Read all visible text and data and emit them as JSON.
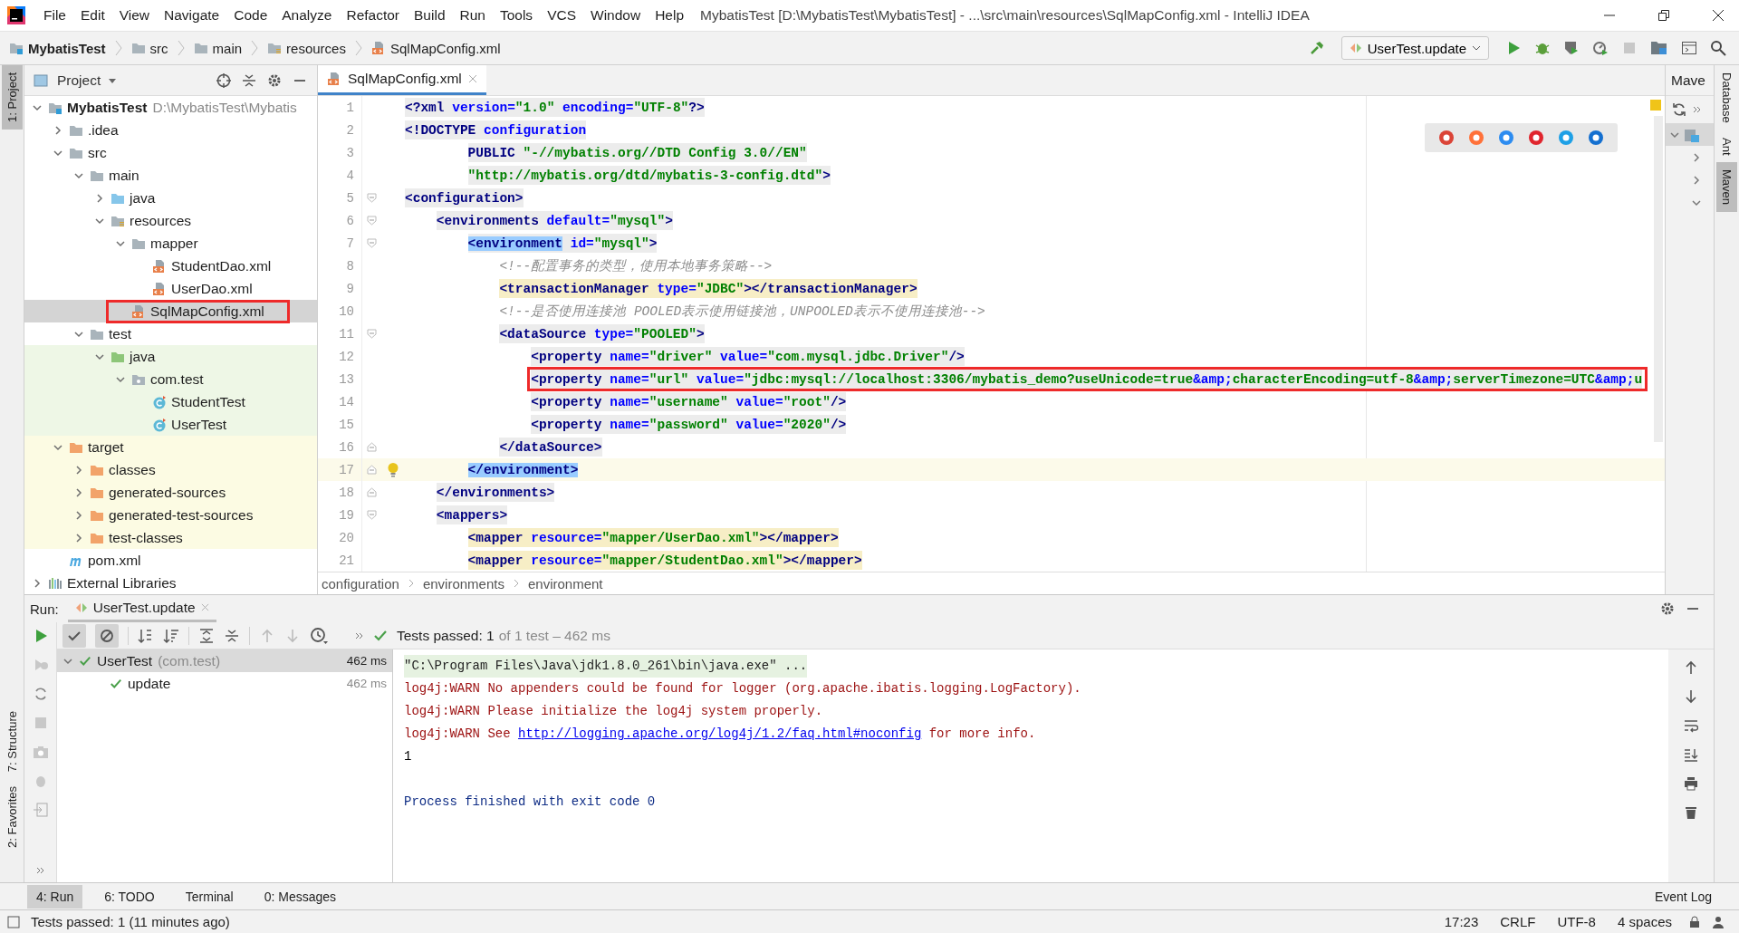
{
  "window": {
    "title": "MybatisTest [D:\\MybatisTest\\MybatisTest] - ...\\src\\main\\resources\\SqlMapConfig.xml - IntelliJ IDEA"
  },
  "menu": [
    "File",
    "Edit",
    "View",
    "Navigate",
    "Code",
    "Analyze",
    "Refactor",
    "Build",
    "Run",
    "Tools",
    "VCS",
    "Window",
    "Help"
  ],
  "breadcrumbs": [
    {
      "label": "MybatisTest",
      "kind": "module"
    },
    {
      "label": "src",
      "kind": "folder"
    },
    {
      "label": "main",
      "kind": "folder"
    },
    {
      "label": "resources",
      "kind": "resources-folder"
    },
    {
      "label": "SqlMapConfig.xml",
      "kind": "xml"
    }
  ],
  "run_config": "UserTest.update",
  "left_tool_windows": [
    {
      "label": "1: Project",
      "selected": true
    },
    {
      "label": "7: Structure",
      "selected": false
    },
    {
      "label": "2: Favorites",
      "selected": false
    }
  ],
  "right_tool_windows": [
    {
      "label": "Database",
      "selected": false
    },
    {
      "label": "Ant",
      "selected": false
    },
    {
      "label": "Maven",
      "selected": true
    }
  ],
  "project": {
    "title": "Project",
    "tree": [
      {
        "label": "MybatisTest",
        "path": "D:\\MybatisTest\\Mybatis",
        "kind": "module",
        "expanded": true,
        "selected": false,
        "children": [
          {
            "label": ".idea",
            "kind": "folder",
            "expanded": false,
            "selected": false
          },
          {
            "label": "src",
            "kind": "folder",
            "expanded": true,
            "selected": false,
            "children": [
              {
                "label": "main",
                "kind": "folder",
                "expanded": true,
                "selected": false,
                "children": [
                  {
                    "label": "java",
                    "kind": "source-folder",
                    "expanded": false,
                    "selected": false
                  },
                  {
                    "label": "resources",
                    "kind": "resources-folder",
                    "expanded": true,
                    "selected": false,
                    "children": [
                      {
                        "label": "mapper",
                        "kind": "folder",
                        "expanded": true,
                        "selected": false,
                        "children": [
                          {
                            "label": "StudentDao.xml",
                            "kind": "xml",
                            "selected": false
                          },
                          {
                            "label": "UserDao.xml",
                            "kind": "xml",
                            "selected": false
                          }
                        ]
                      },
                      {
                        "label": "SqlMapConfig.xml",
                        "kind": "xml",
                        "selected": true,
                        "annotated": true
                      }
                    ]
                  }
                ]
              },
              {
                "label": "test",
                "kind": "folder",
                "expanded": true,
                "selected": false,
                "children": [
                  {
                    "label": "java",
                    "kind": "test-folder",
                    "color": "#eef7e6",
                    "expanded": true,
                    "selected": false,
                    "children": [
                      {
                        "label": "com.test",
                        "kind": "package",
                        "color": "#eef7e6",
                        "expanded": true,
                        "selected": false,
                        "children": [
                          {
                            "label": "StudentTest",
                            "kind": "class",
                            "color": "#eef7e6",
                            "selected": false
                          },
                          {
                            "label": "UserTest",
                            "kind": "class",
                            "color": "#eef7e6",
                            "selected": false
                          }
                        ]
                      }
                    ]
                  }
                ]
              }
            ]
          },
          {
            "label": "target",
            "kind": "excluded-folder",
            "color": "#fcfbe3",
            "expanded": true,
            "selected": false,
            "children": [
              {
                "label": "classes",
                "kind": "excluded-folder",
                "color": "#fcfbe3",
                "expanded": false,
                "selected": false
              },
              {
                "label": "generated-sources",
                "kind": "excluded-folder",
                "color": "#fcfbe3",
                "expanded": false,
                "selected": false
              },
              {
                "label": "generated-test-sources",
                "kind": "excluded-folder",
                "color": "#fcfbe3",
                "expanded": false,
                "selected": false
              },
              {
                "label": "test-classes",
                "kind": "excluded-folder",
                "color": "#fcfbe3",
                "expanded": false,
                "selected": false
              }
            ]
          },
          {
            "label": "pom.xml",
            "kind": "maven",
            "selected": false
          }
        ]
      },
      {
        "label": "External Libraries",
        "kind": "library",
        "expanded": false,
        "selected": false
      }
    ]
  },
  "editor": {
    "tab": "SqlMapConfig.xml",
    "lines": [
      {
        "number": "1",
        "color": "#ececec",
        "current": false,
        "tokens": [
          {
            "kind": "tag",
            "text": "<?xml"
          },
          {
            "kind": "attr",
            "text": " version="
          },
          {
            "kind": "value",
            "text": "\"1.0\""
          },
          {
            "kind": "attr",
            "text": " encoding="
          },
          {
            "kind": "value",
            "text": "\"UTF-8\""
          },
          {
            "kind": "tag",
            "text": "?>"
          }
        ]
      },
      {
        "number": "2",
        "color": "#ececec",
        "current": false,
        "tokens": [
          {
            "kind": "tag",
            "text": "<!DOCTYPE"
          },
          {
            "kind": "attr",
            "text": " configuration"
          }
        ]
      },
      {
        "number": "3",
        "color": "#ececec",
        "current": false,
        "continuation": true,
        "tokens": [
          {
            "kind": "tag",
            "text": "PUBLIC"
          },
          {
            "kind": "value",
            "text": " \"-//mybatis.org//DTD Config 3.0//EN\""
          }
        ]
      },
      {
        "number": "4",
        "color": "#ececec",
        "current": false,
        "continuation": true,
        "tokens": [
          {
            "kind": "value",
            "text": "\"http://mybatis.org/dtd/mybatis-3-config.dtd\""
          },
          {
            "kind": "tag",
            "text": ">"
          }
        ]
      },
      {
        "number": "5",
        "color": "#ececec",
        "current": false,
        "fold_start": true,
        "tokens": [
          {
            "kind": "tag",
            "text": "<configuration>"
          }
        ]
      },
      {
        "number": "6",
        "color": "#ececec",
        "current": false,
        "fold_start": true,
        "tokens": [
          {
            "kind": "tag",
            "text": "<environments"
          },
          {
            "kind": "attr",
            "text": " default="
          },
          {
            "kind": "value",
            "text": "\"mysql\""
          },
          {
            "kind": "tag",
            "text": ">"
          }
        ]
      },
      {
        "number": "7",
        "color": "#ececec",
        "current": false,
        "fold_start": true,
        "tokens": [
          {
            "kind": "matched",
            "text": "<environment"
          },
          {
            "kind": "attr",
            "text": " id="
          },
          {
            "kind": "value",
            "text": "\"mysql\""
          },
          {
            "kind": "tag",
            "text": ">"
          }
        ]
      },
      {
        "number": "8",
        "current": false,
        "tokens": [
          {
            "kind": "comment",
            "text": "<!--配置事务的类型，使用本地事务策略-->"
          }
        ]
      },
      {
        "number": "9",
        "color": "#f7eec6",
        "current": false,
        "tokens": [
          {
            "kind": "tag",
            "text": "<transactionManager"
          },
          {
            "kind": "attr",
            "text": " type="
          },
          {
            "kind": "value",
            "text": "\"JDBC\""
          },
          {
            "kind": "tag",
            "text": "></transactionManager>"
          }
        ]
      },
      {
        "number": "10",
        "current": false,
        "tokens": [
          {
            "kind": "comment",
            "text": "<!--是否使用连接池 POOLED表示使用链接池，UNPOOLED表示不使用连接池-->"
          }
        ]
      },
      {
        "number": "11",
        "color": "#ececec",
        "current": false,
        "fold_start": true,
        "tokens": [
          {
            "kind": "tag",
            "text": "<dataSource"
          },
          {
            "kind": "attr",
            "text": " type="
          },
          {
            "kind": "value",
            "text": "\"POOLED\""
          },
          {
            "kind": "tag",
            "text": ">"
          }
        ]
      },
      {
        "number": "12",
        "color": "#ececec",
        "current": false,
        "tokens": [
          {
            "kind": "tag",
            "text": "<property"
          },
          {
            "kind": "attr",
            "text": " name="
          },
          {
            "kind": "value",
            "text": "\"driver\""
          },
          {
            "kind": "attr",
            "text": " value="
          },
          {
            "kind": "value",
            "text": "\"com.mysql.jdbc.Driver\""
          },
          {
            "kind": "tag",
            "text": "/>"
          }
        ]
      },
      {
        "number": "13",
        "color": "#ececec",
        "current": false,
        "annotated": true,
        "tokens": [
          {
            "kind": "tag",
            "text": "<property"
          },
          {
            "kind": "attr",
            "text": " name="
          },
          {
            "kind": "value",
            "text": "\"url\""
          },
          {
            "kind": "attr",
            "text": " value="
          },
          {
            "kind": "value",
            "text": "\"jdbc:mysql://localhost:3306/mybatis_demo?useUnicode=true"
          },
          {
            "kind": "entity",
            "text": "&amp;"
          },
          {
            "kind": "value",
            "text": "characterEncoding=utf-8"
          },
          {
            "kind": "entity",
            "text": "&amp;"
          },
          {
            "kind": "value",
            "text": "serverTimezone=UTC"
          },
          {
            "kind": "entity",
            "text": "&amp;"
          },
          {
            "kind": "value",
            "text": "u"
          }
        ]
      },
      {
        "number": "14",
        "color": "#ececec",
        "current": false,
        "tokens": [
          {
            "kind": "tag",
            "text": "<property"
          },
          {
            "kind": "attr",
            "text": " name="
          },
          {
            "kind": "value",
            "text": "\"username\""
          },
          {
            "kind": "attr",
            "text": " value="
          },
          {
            "kind": "value",
            "text": "\"root\""
          },
          {
            "kind": "tag",
            "text": "/>"
          }
        ]
      },
      {
        "number": "15",
        "color": "#ececec",
        "current": false,
        "tokens": [
          {
            "kind": "tag",
            "text": "<property"
          },
          {
            "kind": "attr",
            "text": " name="
          },
          {
            "kind": "value",
            "text": "\"password\""
          },
          {
            "kind": "attr",
            "text": " value="
          },
          {
            "kind": "value",
            "text": "\"2020\""
          },
          {
            "kind": "tag",
            "text": "/>"
          }
        ]
      },
      {
        "number": "16",
        "color": "#ececec",
        "current": false,
        "fold_end": true,
        "tokens": [
          {
            "kind": "tag",
            "text": "</dataSource>"
          }
        ]
      },
      {
        "number": "17",
        "current": true,
        "fold_end": true,
        "tokens": [
          {
            "kind": "matched",
            "text": "</environment>"
          }
        ]
      },
      {
        "number": "18",
        "color": "#ececec",
        "current": false,
        "fold_end": true,
        "tokens": [
          {
            "kind": "tag",
            "text": "</environments>"
          }
        ]
      },
      {
        "number": "19",
        "color": "#ececec",
        "current": false,
        "fold_start": true,
        "tokens": [
          {
            "kind": "tag",
            "text": "<mappers>"
          }
        ]
      },
      {
        "number": "20",
        "color": "#f7eec6",
        "current": false,
        "tokens": [
          {
            "kind": "tag",
            "text": "<mapper"
          },
          {
            "kind": "attr",
            "text": " resource="
          },
          {
            "kind": "value",
            "text": "\"mapper/UserDao.xml\""
          },
          {
            "kind": "tag",
            "text": "></mapper>"
          }
        ]
      },
      {
        "number": "21",
        "color": "#f7eec6",
        "current": false,
        "tokens": [
          {
            "kind": "tag",
            "text": "<mapper"
          },
          {
            "kind": "attr",
            "text": " resource="
          },
          {
            "kind": "value",
            "text": "\"mapper/StudentDao.xml\""
          },
          {
            "kind": "tag",
            "text": "></mapper>"
          }
        ]
      }
    ],
    "breadcrumb": [
      "configuration",
      "environments",
      "environment"
    ]
  },
  "maven": {
    "title": "Mave"
  },
  "run": {
    "label": "Run:",
    "tab": "UserTest.update",
    "show_passed": true,
    "show_ignored": true,
    "status": "Tests passed: 1",
    "status_detail": "of 1 test – 462 ms",
    "tests": [
      {
        "name": "UserTest",
        "detail": "(com.test)",
        "time": "462 ms",
        "passed": true,
        "expanded": true,
        "selected": true,
        "children": [
          {
            "name": "update",
            "time": "462 ms",
            "passed": true,
            "selected": false
          }
        ]
      }
    ],
    "console": [
      {
        "kind": "command",
        "text": "\"C:\\Program Files\\Java\\jdk1.8.0_261\\bin\\java.exe\" ..."
      },
      {
        "kind": "warn",
        "text": "log4j:WARN No appenders could be found for logger (org.apache.ibatis.logging.LogFactory)."
      },
      {
        "kind": "warn",
        "text": "log4j:WARN Please initialize the log4j system properly."
      },
      {
        "kind": "warn",
        "text": "log4j:WARN See ",
        "link": "http://logging.apache.org/log4j/1.2/faq.html#noconfig",
        "after": " for more info."
      },
      {
        "kind": "output",
        "text": "1"
      },
      {
        "kind": "process",
        "text": "Process finished with exit code 0"
      }
    ]
  },
  "bottom_tabs": [
    {
      "label": "4: Run",
      "selected": true
    },
    {
      "label": "6: TODO",
      "selected": false
    },
    {
      "label": "Terminal",
      "selected": false
    },
    {
      "label": "0: Messages",
      "selected": false
    }
  ],
  "event_log": "Event Log",
  "status_bar": {
    "message": "Tests passed: 1 (11 minutes ago)",
    "items": [
      "17:23",
      "CRLF",
      "UTF-8",
      "4 spaces"
    ]
  }
}
